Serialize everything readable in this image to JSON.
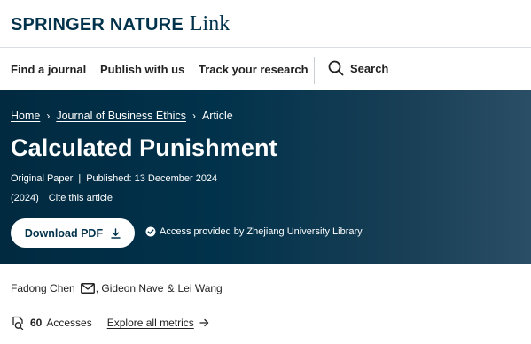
{
  "header": {
    "logo_brand": "SPRINGER NATURE",
    "logo_suffix": "Link"
  },
  "nav": {
    "items": [
      {
        "label": "Find a journal"
      },
      {
        "label": "Publish with us"
      },
      {
        "label": "Track your research"
      }
    ],
    "search_label": "Search",
    "search_icon": "search-icon"
  },
  "article": {
    "breadcrumb": {
      "home": "Home",
      "journal": "Journal of Business Ethics",
      "current": "Article"
    },
    "title": "Calculated Punishment",
    "type": "Original Paper",
    "separator": "|",
    "published": "Published: 13 December 2024",
    "year": "(2024)",
    "cite_label": "Cite this article",
    "download_label": "Download PDF",
    "access_text": "Access provided by Zhejiang University Library"
  },
  "authors": {
    "first": "Fadong Chen",
    "second": "Gideon Nave",
    "joiner": "&",
    "third": "Lei Wang"
  },
  "metrics": {
    "count": "60",
    "label": "Accesses",
    "explore_label": "Explore all metrics"
  },
  "colors": {
    "brand_navy": "#01324b",
    "hero_gradient_end": "#2a4e65",
    "text": "#222222"
  }
}
